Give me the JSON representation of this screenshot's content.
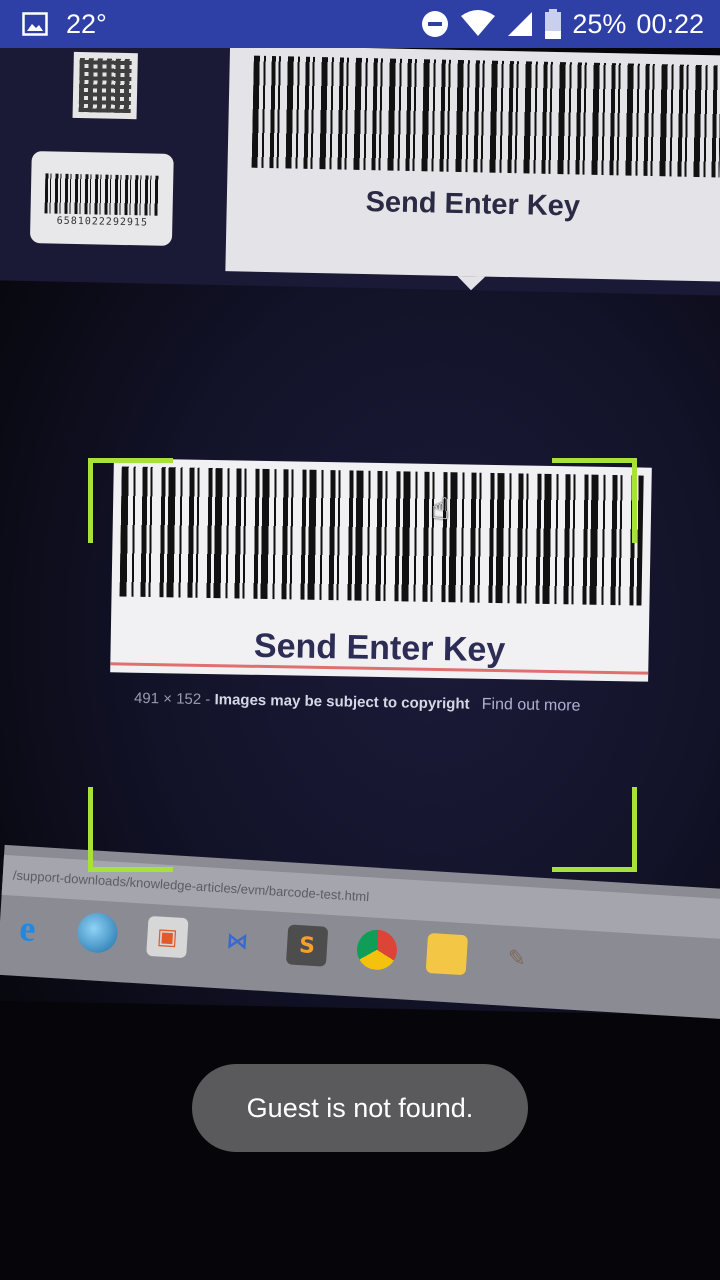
{
  "status_bar": {
    "temperature": "22°",
    "battery_percent": "25%",
    "time": "00:22",
    "icons": [
      "gallery-icon",
      "do-not-disturb-icon",
      "wifi-icon",
      "cell-signal-icon",
      "battery-icon"
    ],
    "background_color": "#2e3fa6"
  },
  "scene": {
    "top_barcode_label": "Send Enter Key",
    "small_barcode_digits": "6581022292915",
    "main_barcode_label": "Send Enter Key",
    "caption": {
      "dimensions": "491 × 152",
      "separator": "-",
      "notice": "Images may be subject to copyright",
      "link": "Find out more"
    },
    "url_text": "/support-downloads/knowledge-articles/evm/barcode-test.html",
    "taskbar_icons": [
      "edge-icon",
      "globe-icon",
      "store-icon",
      "visual-studio-icon",
      "sublime-icon",
      "chrome-icon",
      "files-icon",
      "gimp-icon"
    ]
  },
  "scanner": {
    "frame_color": "#a7e23b"
  },
  "toast": {
    "message": "Guest is not found."
  }
}
